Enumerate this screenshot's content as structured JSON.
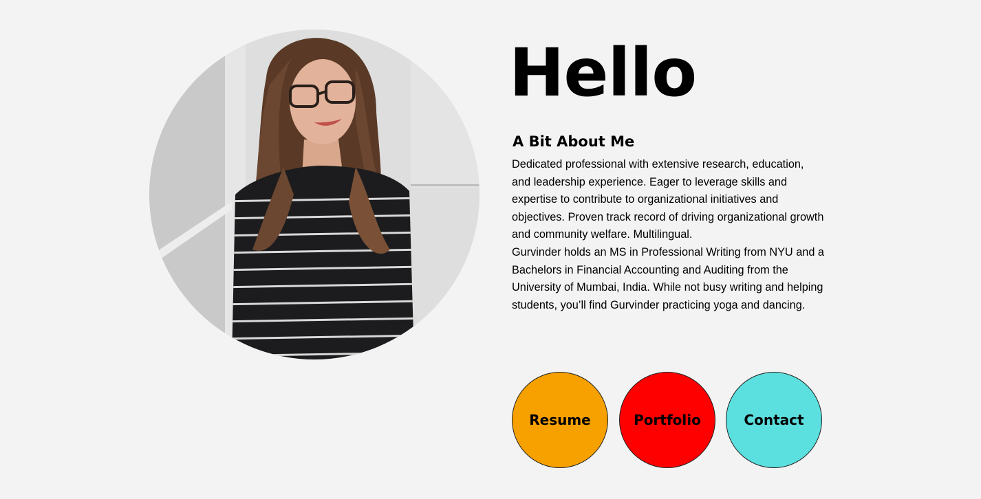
{
  "hero": {
    "title": "Hello",
    "photo_alt": "Portrait of Gurvinder"
  },
  "about": {
    "heading": "A Bit About Me",
    "paragraph1": "Dedicated professional with extensive research, education, and leadership experience. Eager to leverage skills and expertise to contribute to organizational initiatives and objectives. Proven track record of driving organizational growth and community welfare. Multilingual.",
    "paragraph2": "Gurvinder holds an MS in Professional Writing from NYU and a Bachelors in Financial Accounting and Auditing from the University of Mumbai, India. While not busy writing and helping students, you’ll find Gurvinder practicing yoga and dancing."
  },
  "buttons": {
    "resume": {
      "label": "Resume",
      "color": "#f7a100"
    },
    "portfolio": {
      "label": "Portfolio",
      "color": "#ff0000"
    },
    "contact": {
      "label": "Contact",
      "color": "#5cdfdf"
    }
  },
  "colors": {
    "background": "#f3f3f3",
    "text": "#000000"
  }
}
